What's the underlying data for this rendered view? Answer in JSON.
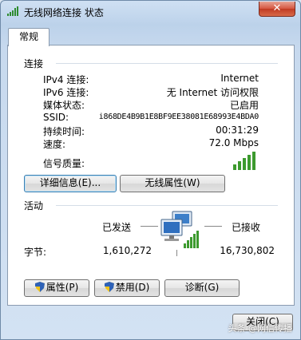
{
  "window": {
    "title": "无线网络连接 状态",
    "close_glyph": "✕"
  },
  "tabs": [
    {
      "label": "常规"
    }
  ],
  "connection": {
    "heading": "连接",
    "rows": [
      {
        "label": "IPv4 连接:",
        "value": "Internet"
      },
      {
        "label": "IPv6 连接:",
        "value": "无 Internet 访问权限"
      },
      {
        "label": "媒体状态:",
        "value": "已启用"
      },
      {
        "label": "SSID:",
        "value": "i868DE4B9B1E8BF9EE38081E68993E4BDA0"
      },
      {
        "label": "持续时间:",
        "value": "00:31:29"
      },
      {
        "label": "速度:",
        "value": "72.0 Mbps"
      }
    ],
    "signal_label": "信号质量:",
    "signal_icon": "signal-bars-icon",
    "buttons": {
      "details": "详细信息(E)...",
      "wireless_props": "无线属性(W)"
    }
  },
  "activity": {
    "heading": "活动",
    "sent_label": "已发送",
    "received_label": "已接收",
    "bytes_label": "字节:",
    "bytes_sent": "1,610,272",
    "bytes_received": "16,730,802",
    "network_icon": "network-computers-icon"
  },
  "actions": {
    "properties": "属性(P)",
    "disable": "禁用(D)",
    "diagnose": "诊断(G)",
    "shield_icon": "uac-shield-icon"
  },
  "footer": {
    "close": "关闭(C)"
  },
  "watermark": "头条 @网信传播",
  "colors": {
    "accent": "#3c9a2e",
    "titlebar": "#cfe0f3"
  }
}
